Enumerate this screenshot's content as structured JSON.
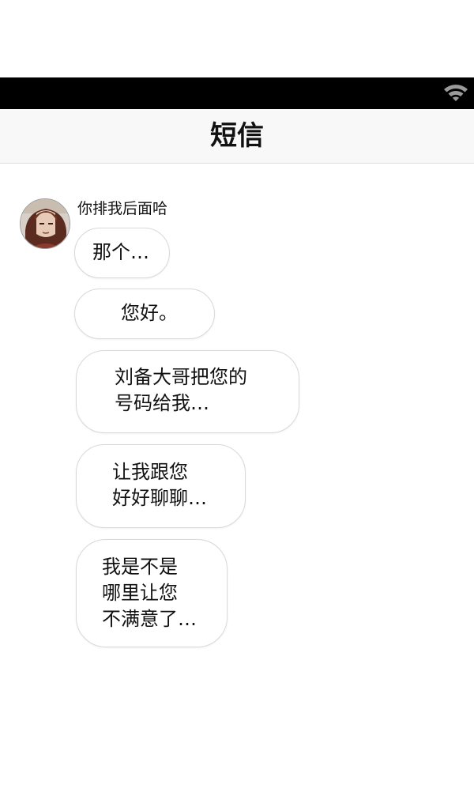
{
  "status_bar": {
    "wifi_icon": "wifi-icon",
    "background": "#000000"
  },
  "header": {
    "title": "短信"
  },
  "conversation": {
    "sender_name": "你排我后面哈",
    "avatar_icon": "avatar",
    "messages": [
      "那个…",
      "您好。",
      "刘备大哥把您的\n号码给我…",
      "让我跟您\n好好聊聊…",
      "我是不是\n哪里让您\n不满意了…"
    ]
  }
}
